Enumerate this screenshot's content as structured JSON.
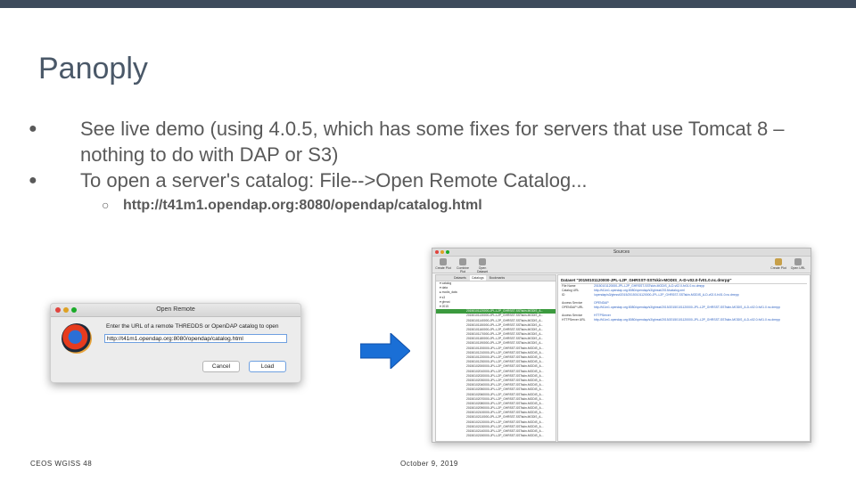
{
  "slide": {
    "title": "Panoply",
    "bullets": [
      "See live demo (using 4.0.5, which has some fixes for servers that use Tomcat 8 – nothing to do with DAP or S3)",
      "To open a server's catalog: File-->Open Remote Catalog..."
    ],
    "sub_bullet": "http://t41m1.opendap.org:8080/opendap/catalog.html",
    "footer_left": "CEOS WGISS 48",
    "footer_center": "October 9, 2019"
  },
  "dialog": {
    "title": "Open Remote",
    "message": "Enter the URL of a remote THREDDS or OpenDAP catalog to open",
    "input_value": "http://t41m1.opendap.org:8080/opendap/catalog.html",
    "cancel_label": "Cancel",
    "load_label": "Load",
    "icon": "panoply-logo-icon"
  },
  "arrow": {
    "icon": "right-arrow-icon",
    "color": "#1a6fd6"
  },
  "browser": {
    "title": "Sources",
    "toolbar_left": [
      "Create Plot",
      "Combine Plot",
      "Open Dataset"
    ],
    "toolbar_right": [
      "Create Plot",
      "Open URL"
    ],
    "tabs": [
      "Datasets",
      "Catalogs",
      "Bookmarks"
    ],
    "tree": [
      "▾ catalog",
      "  ▾ data",
      "    ▸ modis_data",
      "    ▾ s3",
      "      ▾ ghrsst",
      "        ▾ 2015",
      "20150101120000-JPL-L2P_GHRSST-SSTskin-MODIS_A...",
      "20150101130000-JPL-L2P_GHRSST-SSTskin-MODIS_A...",
      "20150101140000-JPL-L2P_GHRSST-SSTskin-MODIS_A...",
      "20150101150000-JPL-L2P_GHRSST-SSTskin-MODIS_A...",
      "20150101160000-JPL-L2P_GHRSST-SSTskin-MODIS_A...",
      "20150101170000-JPL-L2P_GHRSST-SSTskin-MODIS_A...",
      "20150101180000-JPL-L2P_GHRSST-SSTskin-MODIS_A...",
      "20150101190000-JPL-L2P_GHRSST-SSTskin-MODIS_A...",
      "20150101200000-JPL-L2P_GHRSST-SSTskin-MODIS_A...",
      "20150101210000-JPL-L2P_GHRSST-SSTskin-MODIS_A...",
      "20150101220000-JPL-L2P_GHRSST-SSTskin-MODIS_A...",
      "20150101230000-JPL-L2P_GHRSST-SSTskin-MODIS_A...",
      "20150102000000-JPL-L2P_GHRSST-SSTskin-MODIS_A...",
      "20150102010000-JPL-L2P_GHRSST-SSTskin-MODIS_A...",
      "20150102020000-JPL-L2P_GHRSST-SSTskin-MODIS_A...",
      "20150102030000-JPL-L2P_GHRSST-SSTskin-MODIS_A...",
      "20150102040000-JPL-L2P_GHRSST-SSTskin-MODIS_A...",
      "20150102050000-JPL-L2P_GHRSST-SSTskin-MODIS_A...",
      "20150102060000-JPL-L2P_GHRSST-SSTskin-MODIS_A...",
      "20150102070000-JPL-L2P_GHRSST-SSTskin-MODIS_A...",
      "20150102080000-JPL-L2P_GHRSST-SSTskin-MODIS_A...",
      "20150102090000-JPL-L2P_GHRSST-SSTskin-MODIS_A...",
      "20150102100000-JPL-L2P_GHRSST-SSTskin-MODIS_A...",
      "20150102110000-JPL-L2P_GHRSST-SSTskin-MODIS_A...",
      "20150102120000-JPL-L2P_GHRSST-SSTskin-MODIS_A...",
      "20150102130000-JPL-L2P_GHRSST-SSTskin-MODIS_A...",
      "20150102140000-JPL-L2P_GHRSST-SSTskin-MODIS_A...",
      "20150102150000-JPL-L2P_GHRSST-SSTskin-MODIS_A..."
    ],
    "selected_index": 6,
    "detail_title": "Dataset \"20150101120000-JPL-L2P_GHRSST-SSTskin-MODIS_A-D-v02.0-fv01.0.nc.dmrpp\"",
    "detail_rows": [
      {
        "k": "File Name",
        "v": "20150101120000-JPL-L2P_GHRSST-SSTskin-MODIS_A-D-v02.0-fv01.0.nc.dmrpp"
      },
      {
        "k": "Catalog URL",
        "v": "http://t41m1.opendap.org:8080/opendap/s3/ghrsst/2015/catalog.xml"
      },
      {
        "k": "ID",
        "v": "/opendap/s3/ghrsst/2015/20150101120000-JPL-L2P_GHRSST-SSTskin-MODIS_A-D-v02.0-fv01.0.nc.dmrpp"
      },
      {
        "k": "",
        "v": ""
      },
      {
        "k": "Access Service",
        "v": "OPENDAP"
      },
      {
        "k": "OPENDAP URL",
        "v": "http://t41m1.opendap.org:8080/opendap/s3/ghrsst/2015/20150101120000-JPL-L2P_GHRSST-SSTskin-MODIS_A-D-v02.0-fv01.0.nc.dmrpp"
      },
      {
        "k": "",
        "v": ""
      },
      {
        "k": "Access Service",
        "v": "HTTPServer"
      },
      {
        "k": "HTTPServer URL",
        "v": "http://t41m1.opendap.org:8080/opendap/s3/ghrsst/2015/20150101120000-JPL-L2P_GHRSST-SSTskin-MODIS_A-D-v02.0-fv01.0.nc.dmrpp"
      }
    ]
  }
}
